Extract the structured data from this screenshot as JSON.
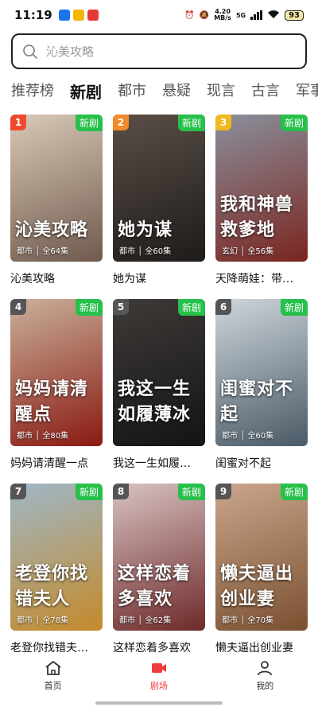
{
  "status_bar": {
    "time": "11:19",
    "net_speed_top": "4.20",
    "net_speed_bottom": "MB/s",
    "network": "5G",
    "battery": "93",
    "app_colors": [
      "#1a73e8",
      "#f5b400",
      "#e53935"
    ]
  },
  "search": {
    "placeholder": "沁美攻略"
  },
  "tabs": [
    {
      "label": "推荐榜",
      "active": false
    },
    {
      "label": "新剧",
      "active": true
    },
    {
      "label": "都市",
      "active": false
    },
    {
      "label": "悬疑",
      "active": false
    },
    {
      "label": "现言",
      "active": false
    },
    {
      "label": "古言",
      "active": false
    },
    {
      "label": "军事",
      "active": false
    }
  ],
  "badge_label": "新剧",
  "items": [
    {
      "rank": "1",
      "title": "沁美攻略",
      "genre": "都市",
      "episodes": "全64集",
      "poster_text": "沁美攻略",
      "rank_color": "#ef4a2d",
      "colors": [
        "#d9c9b8",
        "#6f5a4d"
      ]
    },
    {
      "rank": "2",
      "title": "她为谋",
      "genre": "都市",
      "episodes": "全60集",
      "poster_text": "她为谋",
      "rank_color": "#f28a2b",
      "colors": [
        "#5a4f47",
        "#1e1b1a"
      ]
    },
    {
      "rank": "3",
      "title": "天降萌娃：带…",
      "genre": "玄幻",
      "episodes": "全56集",
      "poster_text": "我和神兽救爹地",
      "rank_color": "#f2b81f",
      "colors": [
        "#8a8f9c",
        "#7a2620"
      ]
    },
    {
      "rank": "4",
      "title": "妈妈请清醒一点",
      "genre": "都市",
      "episodes": "全80集",
      "poster_text": "妈妈请清醒点",
      "rank_color": "#555555",
      "colors": [
        "#c9b09b",
        "#8a1a12"
      ]
    },
    {
      "rank": "5",
      "title": "我这一生如履…",
      "genre": "",
      "episodes": "",
      "poster_text": "我这一生如履薄冰",
      "rank_color": "#555555",
      "colors": [
        "#3e3a38",
        "#141414"
      ]
    },
    {
      "rank": "6",
      "title": "闺蜜对不起",
      "genre": "都市",
      "episodes": "全60集",
      "poster_text": "闺蜜对不起",
      "rank_color": "#555555",
      "colors": [
        "#cfd6dc",
        "#4a5a66"
      ]
    },
    {
      "rank": "7",
      "title": "老登你找错夫…",
      "genre": "都市",
      "episodes": "全78集",
      "poster_text": "老登你找错夫人",
      "rank_color": "#555555",
      "colors": [
        "#9fb7c8",
        "#c48a2a"
      ]
    },
    {
      "rank": "8",
      "title": "这样恋着多喜欢",
      "genre": "都市",
      "episodes": "全62集",
      "poster_text": "这样恋着多喜欢",
      "rank_color": "#555555",
      "colors": [
        "#d8c2c2",
        "#6e2a2a"
      ]
    },
    {
      "rank": "9",
      "title": "懒夫逼出创业妻",
      "genre": "都市",
      "episodes": "全70集",
      "poster_text": "懒夫逼出创业妻",
      "rank_color": "#555555",
      "colors": [
        "#caa68c",
        "#7a5030"
      ]
    }
  ],
  "bottom_nav": [
    {
      "label": "首页",
      "icon": "home-icon",
      "active": false
    },
    {
      "label": "剧场",
      "icon": "theater-icon",
      "active": true
    },
    {
      "label": "我的",
      "icon": "profile-icon",
      "active": false
    }
  ],
  "accent_color": "#ee3b3b",
  "badge_color": "#27c04a"
}
